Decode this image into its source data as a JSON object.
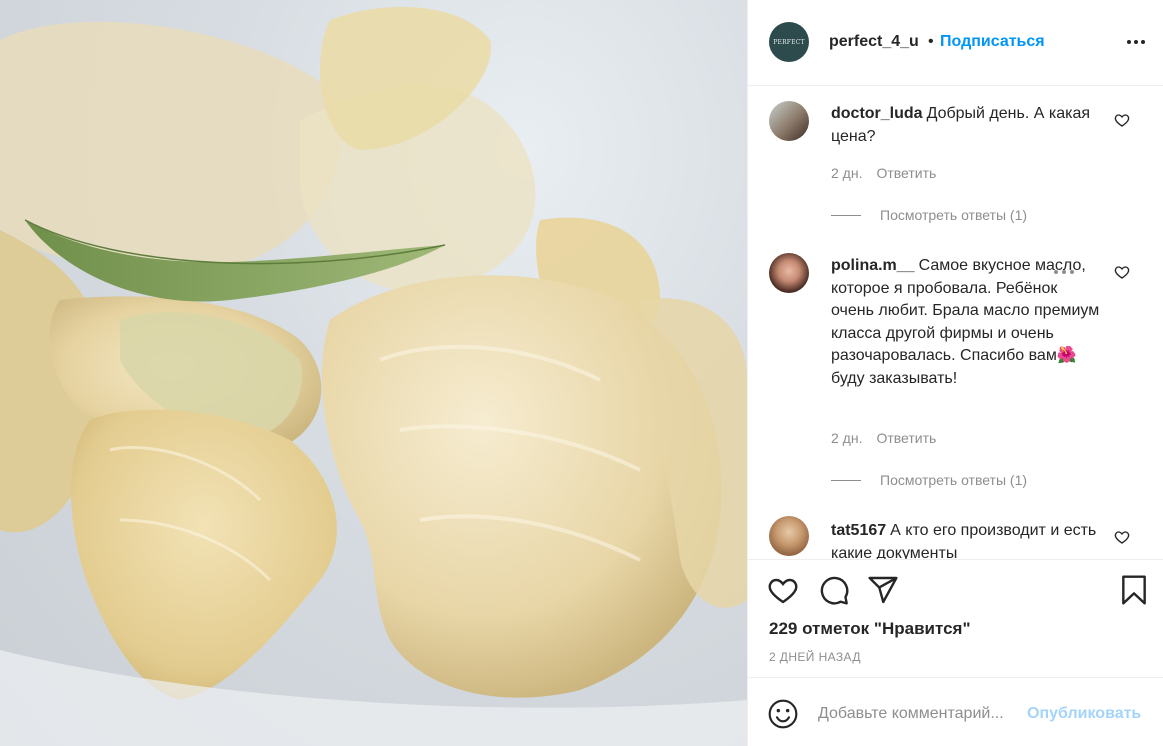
{
  "post": {
    "image_alt": "cocoa butter pieces with a green leaf",
    "author": {
      "avatar_text": "PERFECT",
      "username": "perfect_4_u",
      "separator": "•",
      "follow_label": "Подписаться"
    }
  },
  "comments": [
    {
      "username": "doctor_luda",
      "text": "Добрый день. А какая цена?",
      "time": "2 дн.",
      "reply_label": "Ответить",
      "view_replies": "Посмотреть ответы (1)"
    },
    {
      "username": "polina.m__",
      "text": "Самое вкусное масло, которое я пробовала. Ребёнок очень любит. Брала масло премиум класса другой фирмы и очень разочаровалась. Спасибо вам🌺 буду заказывать!",
      "time": "2 дн.",
      "reply_label": "Ответить",
      "view_replies": "Посмотреть ответы (1)"
    },
    {
      "username": "tat5167",
      "text": "А кто его производит и есть какие документы",
      "time": "",
      "reply_label": "",
      "view_replies": ""
    }
  ],
  "actions": {
    "likes_text": "229 отметок \"Нравится\"",
    "time_ago": "2 ДНЕЙ НАЗАД"
  },
  "add_comment": {
    "placeholder": "Добавьте комментарий...",
    "publish_label": "Опубликовать"
  },
  "colors": {
    "accent": "#0095f6",
    "publish_disabled": "#a5d4fb",
    "text": "#262626",
    "muted": "#8e8e8e",
    "border": "#efefef"
  },
  "icons": [
    "more-icon",
    "heart-icon",
    "comment-icon",
    "share-icon",
    "bookmark-icon",
    "emoji-icon"
  ]
}
